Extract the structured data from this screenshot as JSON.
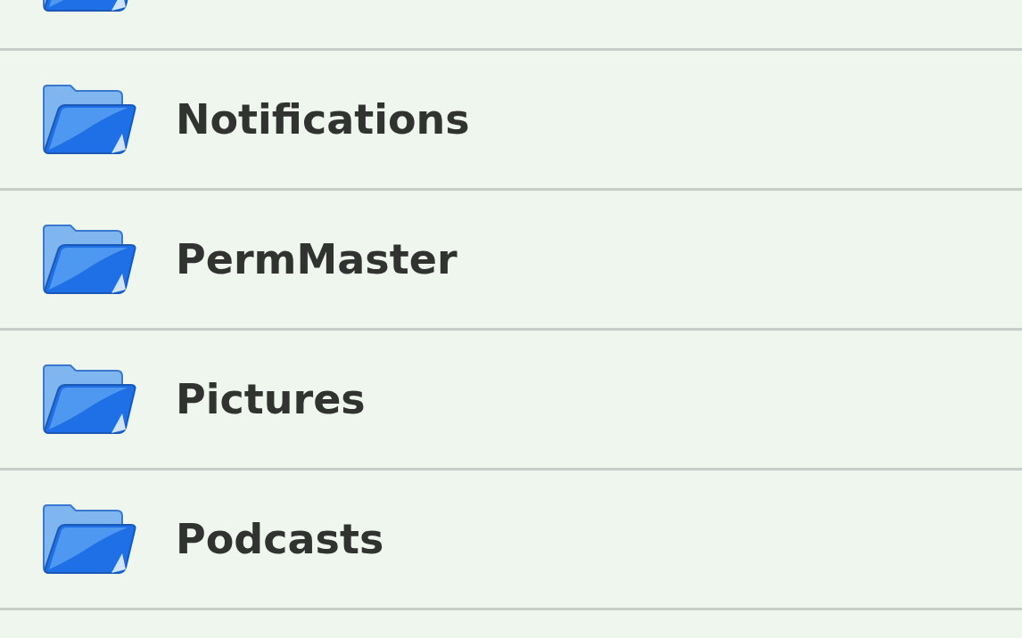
{
  "list": {
    "top_row_cut_off": true,
    "items": [
      {
        "kind": "folder",
        "name": "Notifications"
      },
      {
        "kind": "folder",
        "name": "PermMaster"
      },
      {
        "kind": "folder",
        "name": "Pictures"
      },
      {
        "kind": "folder",
        "name": "Podcasts"
      }
    ]
  }
}
